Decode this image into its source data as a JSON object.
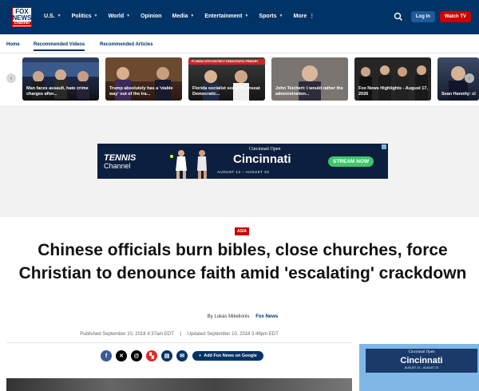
{
  "nav": {
    "logo_line1": "FOX",
    "logo_line2": "NEWS",
    "logo_line3": "channel",
    "items": [
      {
        "label": "U.S."
      },
      {
        "label": "Politics"
      },
      {
        "label": "World"
      },
      {
        "label": "Opinion"
      },
      {
        "label": "Media"
      },
      {
        "label": "Entertainment"
      },
      {
        "label": "Sports"
      },
      {
        "label": "More"
      }
    ],
    "login_label": "Log In",
    "watch_label": "Watch TV"
  },
  "subnav": {
    "tabs": [
      {
        "label": "Home"
      },
      {
        "label": "Recommended Videos"
      },
      {
        "label": "Recommended Articles"
      }
    ]
  },
  "carousel": {
    "cards": [
      {
        "caption": "Man faces assault, hate crime charges after..."
      },
      {
        "caption": "Trump absolutely has a 'viable way' out of the Ira..."
      },
      {
        "caption": "Florida socialist seeks to unseat Democratic..."
      },
      {
        "caption": "John Teichert: I would rather the administration..."
      },
      {
        "caption": "Fox News Highlights - August 17, 2026"
      },
      {
        "caption": "Sean Hannity: clear – modera..."
      }
    ],
    "card3_banner": "FLORIDA 25TH DISTRICT DEMOCRATIC PRIMARY"
  },
  "ad": {
    "tennis_line1": "TENNIS",
    "tennis_line2": "Channel",
    "cin_top": "Cincinnati Open",
    "cin": "Cincinnati",
    "dates": "AUGUST 13 – AUGUST 23",
    "stream": "STREAM NOW",
    "accent": "#3fc66a",
    "background": "#0c1f3f"
  },
  "article": {
    "kicker": "ASIA",
    "headline": "Chinese officials burn bibles, close churches, force Christian to denounce faith amid 'escalating' crackdown",
    "byline_prefix": "By",
    "author": "Lukas Mikelionis",
    "publication": "Fox News",
    "published": "Published September 10, 2018 4:37am EDT",
    "separator": "|",
    "updated": "Updated September 10, 2018 3:46pm EDT",
    "google_label": "Add Fox News on Google",
    "share_icons": [
      "facebook-icon",
      "x-icon",
      "threads-icon",
      "flipboard-icon",
      "print-icon",
      "email-icon"
    ]
  },
  "side_ad": {
    "line1": "Cincinnati Open",
    "line2": "Cincinnati",
    "line3": "AUGUST 13 – AUGUST 23"
  },
  "colors": {
    "brand": "#003366",
    "accent": "#cc0000"
  }
}
